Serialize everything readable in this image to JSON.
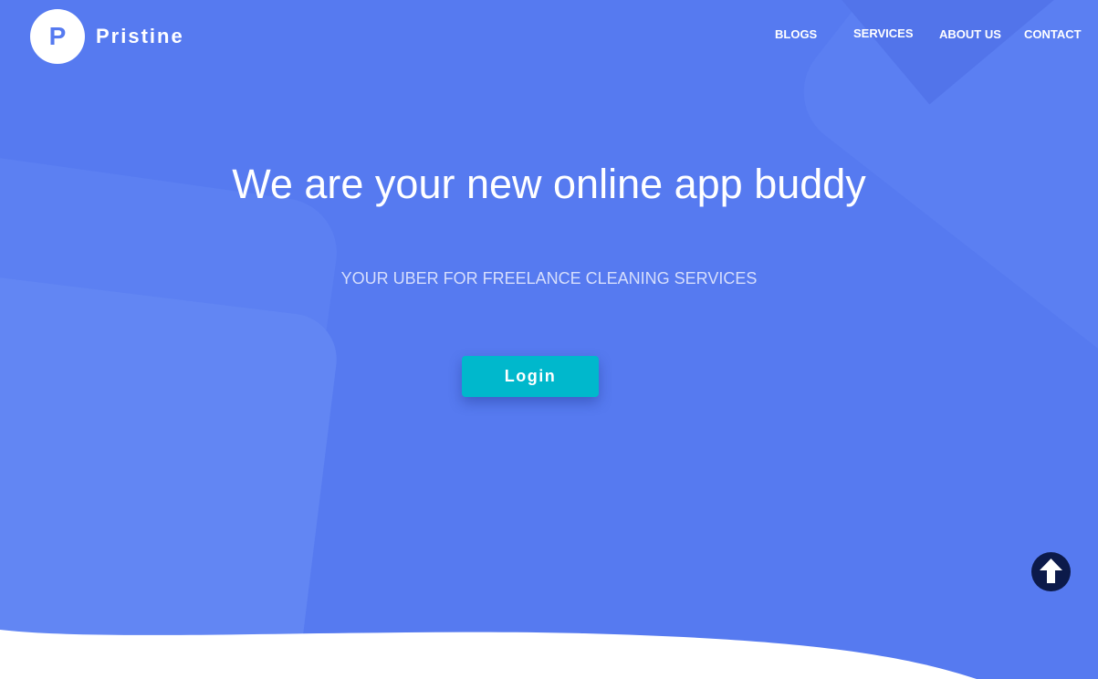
{
  "brand": {
    "logo_letter": "P",
    "name": "Pristine"
  },
  "nav": {
    "items": [
      {
        "label": "BLOGS"
      },
      {
        "label": "SERVICES"
      },
      {
        "label": "ABOUT US"
      },
      {
        "label": "CONTACT"
      }
    ]
  },
  "hero": {
    "headline": "We are your new online app buddy",
    "subtitle": "YOUR UBER FOR FREELANCE CLEANING SERVICES",
    "login_label": "Login"
  },
  "colors": {
    "background": "#567af0",
    "button": "#00b8cc",
    "scroll_top": "#0c1a4a"
  },
  "icons": {
    "scroll_top": "arrow-up-circle-icon"
  }
}
